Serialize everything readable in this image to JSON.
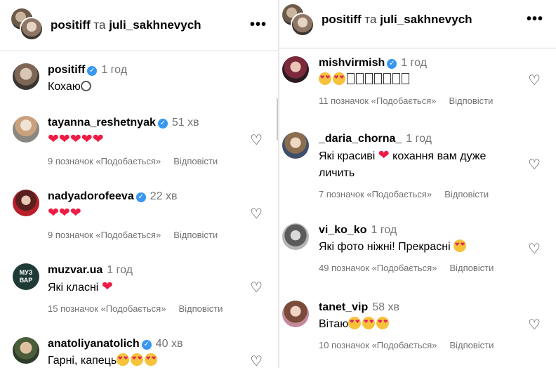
{
  "left": {
    "header": {
      "user1": "positiff",
      "conj": "та",
      "user2": "juli_sakhnevych"
    },
    "comments": [
      {
        "user": "positiff",
        "verified": true,
        "time": "1 год",
        "text": "Кохаю",
        "suffix_icon": "ring",
        "likes": "",
        "reply": "",
        "heart": false
      },
      {
        "user": "tayanna_reshetnyak",
        "verified": true,
        "time": "51 хв",
        "text": "",
        "hearts": 5,
        "likes": "9 позначок «Подобається»",
        "reply": "Відповісти",
        "heart": true
      },
      {
        "user": "nadyadorofeeva",
        "verified": true,
        "time": "22 хв",
        "text": "",
        "hearts": 3,
        "likes": "9 позначок «Подобається»",
        "reply": "Відповісти",
        "heart": true
      },
      {
        "user": "muzvar.ua",
        "verified": false,
        "time": "1 год",
        "text": "Які класні",
        "hearts": 1,
        "likes": "15 позначок «Подобається»",
        "reply": "Відповісти",
        "heart": true,
        "avatar_text": "МУЗ ВАР"
      },
      {
        "user": "anatoliyanatolich",
        "verified": true,
        "time": "40 хв",
        "text": "Гарні, капець",
        "emoji": 3,
        "likes": "",
        "reply": "",
        "heart": true
      }
    ]
  },
  "right": {
    "header": {
      "user1": "positiff",
      "conj": "та",
      "user2": "juli_sakhnevych"
    },
    "comments": [
      {
        "user": "mishvirmish",
        "verified": true,
        "time": "1 год",
        "text": "",
        "emoji": 2,
        "boxes": 7,
        "likes": "11 позначок «Подобається»",
        "reply": "Відповісти"
      },
      {
        "user": "_daria_chorna_",
        "verified": false,
        "time": "1 год",
        "text_a": "Які красиві",
        "text_b": "кохання вам дуже",
        "text_c": "личить",
        "likes": "7 позначок «Подобається»",
        "reply": "Відповісти"
      },
      {
        "user": "vi_ko_ko",
        "verified": false,
        "time": "1 год",
        "text": "Які фото ніжні! Прекрасні",
        "likes": "49 позначок «Подобається»",
        "reply": "Відповісти"
      },
      {
        "user": "tanet_vip",
        "verified": false,
        "time": "58 хв",
        "text": "Вітаю",
        "emoji": 3,
        "likes": "10 позначок «Подобається»",
        "reply": "Відповісти"
      }
    ]
  },
  "colors": {
    "verified": "#3897f0",
    "heart_red": "#ed1c45",
    "meta_gray": "#737373"
  },
  "icons": {
    "verified": "check-badge-icon",
    "like": "heart-outline-icon",
    "more": "more-horizontal-icon"
  }
}
